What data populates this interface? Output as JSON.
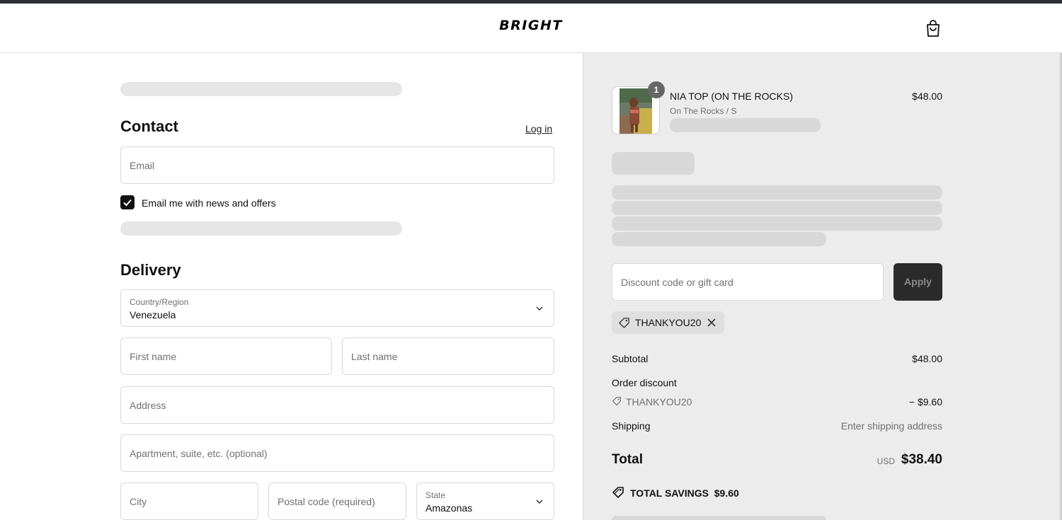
{
  "header": {
    "brand": "BRIGHT",
    "cart_icon": "shopping-bag-icon"
  },
  "contact": {
    "title": "Contact",
    "login_link": "Log in",
    "email_placeholder": "Email",
    "newsletter_label": "Email me with news and offers",
    "newsletter_checked": true
  },
  "delivery": {
    "title": "Delivery",
    "country_label": "Country/Region",
    "country_value": "Venezuela",
    "first_name_placeholder": "First name",
    "last_name_placeholder": "Last name",
    "address_placeholder": "Address",
    "apartment_placeholder": "Apartment, suite, etc. (optional)",
    "city_placeholder": "City",
    "postal_placeholder": "Postal code (required)",
    "state_label": "State",
    "state_value": "Amazonas"
  },
  "order": {
    "item": {
      "name": "NIA TOP (ON THE ROCKS)",
      "variant": "On The Rocks / S",
      "price": "$48.00",
      "quantity": "1"
    },
    "discount_placeholder": "Discount code or gift card",
    "apply_label": "Apply",
    "applied_code": "THANKYOU20",
    "subtotal_label": "Subtotal",
    "subtotal_value": "$48.00",
    "discount_label": "Order discount",
    "discount_code": "THANKYOU20",
    "discount_value": "− $9.60",
    "shipping_label": "Shipping",
    "shipping_value": "Enter shipping address",
    "total_label": "Total",
    "total_currency": "USD",
    "total_value": "$38.40",
    "savings_label": "TOTAL SAVINGS",
    "savings_value": "$9.60"
  },
  "colors": {
    "accent": "#111111",
    "panel_bg": "#ececec",
    "skeleton": "#e6e6e6"
  }
}
